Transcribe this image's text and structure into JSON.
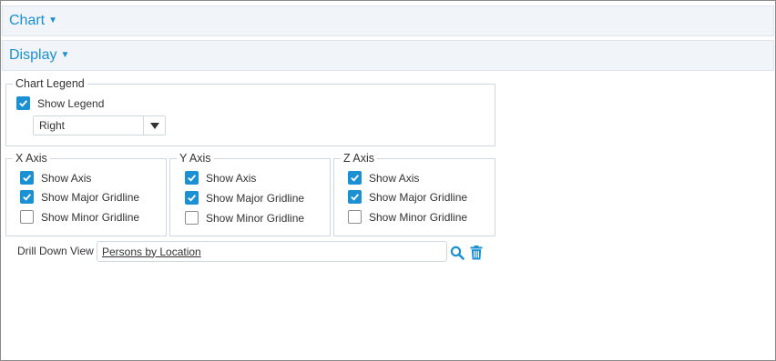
{
  "sections": {
    "chart_label": "Chart",
    "display_label": "Display"
  },
  "chart_legend": {
    "title": "Chart Legend",
    "show_legend_label": "Show Legend",
    "show_legend_checked": true,
    "position_value": "Right"
  },
  "x_axis": {
    "title": "X Axis",
    "show_axis": "Show Axis",
    "major": "Show Major Gridline",
    "minor": "Show Minor Gridline",
    "checked": [
      true,
      true,
      false
    ]
  },
  "y_axis": {
    "title": "Y Axis",
    "show_axis": "Show Axis",
    "major": "Show Major Gridline",
    "minor": "Show Minor Gridline",
    "checked": [
      true,
      true,
      false
    ]
  },
  "z_axis": {
    "title": "Z Axis",
    "show_axis": "Show Axis",
    "major": "Show Major Gridline",
    "minor": "Show Minor Gridline",
    "checked": [
      true,
      true,
      false
    ]
  },
  "drill_down": {
    "label": "Drill Down View",
    "value": "Persons by Location"
  },
  "colors": {
    "accent": "#1b90d2",
    "bar_bg": "#f1f4f8",
    "border": "#cfd6dd"
  },
  "icons": [
    "caret-down-icon",
    "checkmark-icon",
    "search-icon",
    "trash-icon"
  ]
}
